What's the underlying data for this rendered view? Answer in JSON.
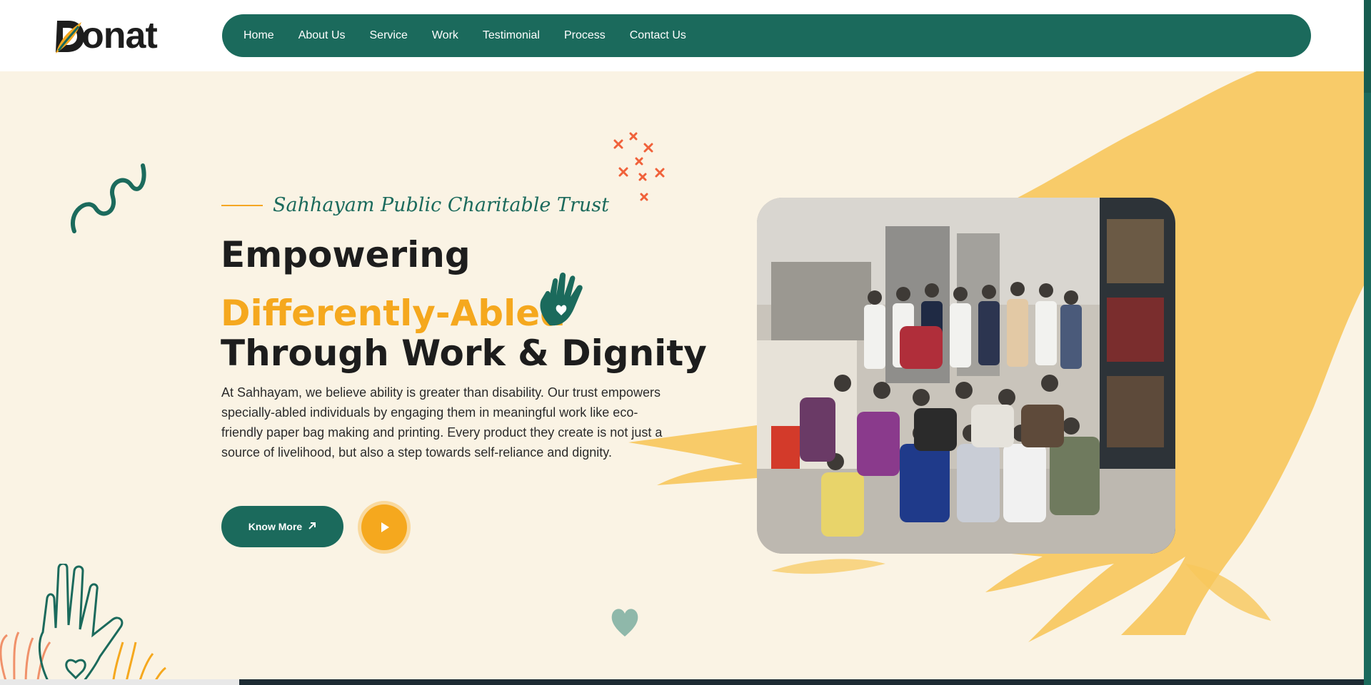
{
  "logo": {
    "text": "onat"
  },
  "nav": {
    "items": [
      {
        "label": "Home"
      },
      {
        "label": "About Us"
      },
      {
        "label": "Service"
      },
      {
        "label": "Work"
      },
      {
        "label": "Testimonial"
      },
      {
        "label": "Process"
      },
      {
        "label": "Contact Us"
      }
    ]
  },
  "hero": {
    "tagline": "Sahhayam Public Charitable Trust",
    "heading_line1": "Empowering",
    "heading_line2": "Differently-Abled",
    "heading_line3": "Through Work & Dignity",
    "description": "At Sahhayam, we believe ability is greater than disability. Our trust empowers specially-abled individuals by engaging them in meaningful work like eco-friendly paper bag making and printing. Every product they create is not just a source of livelihood, but also a step towards self-reliance and dignity.",
    "know_more_label": "Know More",
    "know_more_icon": "arrow-up-right-icon",
    "play_icon": "play-icon"
  },
  "colors": {
    "primary": "#1b6a5c",
    "accent": "#f5a81e",
    "background": "#faf3e4",
    "heading": "#1d1d1d",
    "stars": "#f0613a"
  }
}
